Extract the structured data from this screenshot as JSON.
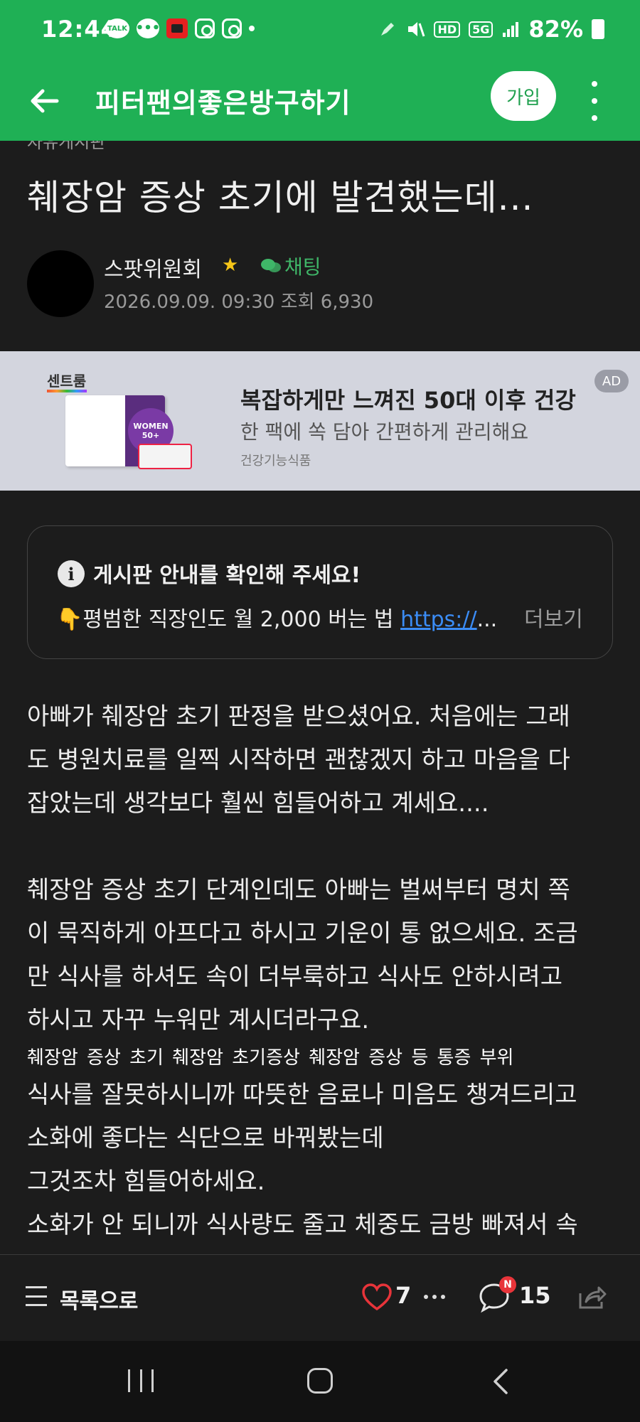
{
  "status_bar": {
    "time": "12:44",
    "talk_label": "TALK",
    "network": "5G",
    "hd": "HD",
    "battery": "82%"
  },
  "app_bar": {
    "title": "피터팬의좋은방구하기",
    "join_label": "가입"
  },
  "post": {
    "board_label": "자유게시판",
    "title": "췌장암 증상 초기에 발견했는데...",
    "author": "스팟위원회",
    "chat_label": "채팅",
    "date": "2026.09.09. 09:30",
    "views": "조회 6,930"
  },
  "ad": {
    "brand": "센트룸",
    "product_badge": "WOMEN 50+",
    "headline": "복잡하게만 느껴진 50대 이후 건강",
    "subline": "한 팩에 쏙 담아 간편하게 관리해요",
    "tag": "건강기능식품",
    "ad_badge": "AD"
  },
  "notice": {
    "title": "게시판 안내를 확인해 주세요!",
    "emoji": "👇",
    "text": "평범한 직장인도 월 2,000 버는 법 ",
    "link": "https://",
    "ellipsis": "...",
    "more_label": "더보기"
  },
  "body": {
    "para1": "아빠가 췌장암 초기 판정을 받으셨어요. 처음에는 그래\n도 병원치료를 일찍 시작하면 괜찮겠지 하고 마음을 다\n잡았는데 생각보다 훨씬 힘들어하고 계세요....",
    "para2": "췌장암 증상 초기 단계인데도 아빠는 벌써부터 명치 쪽\n이 묵직하게 아프다고 하시고 기운이 통 없으세요. 조금\n만 식사를 하셔도 속이 더부룩하고 식사도 안하시려고\n하시고 자꾸 누워만 계시더라구요.",
    "tags": "췌장암 증상 초기  췌장암 초기증상  췌장암 증상 등 통증 부위",
    "para3": "식사를 잘못하시니까 따뜻한 음료나 미음도 챙겨드리고\n소화에 좋다는 식단으로 바꿔봤는데\n그것조차 힘들어하세요.\n소화가 안 되니까 식사량도 줄고 체중도 금방 빠져서 속\n이 타들어가네요"
  },
  "bottom_bar": {
    "list_label": "목록으로",
    "like_count": "7",
    "new_badge": "N",
    "comment_count": "15"
  },
  "colors": {
    "brand_green": "#1fb055",
    "like_red": "#e8343a",
    "link_blue": "#3b8cf5",
    "background": "#1c1c1c"
  }
}
